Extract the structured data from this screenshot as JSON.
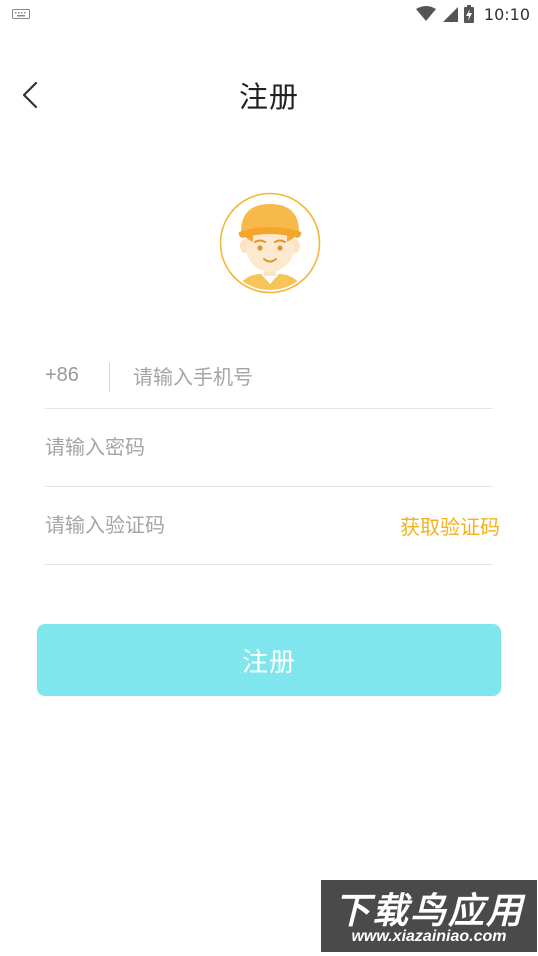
{
  "status_bar": {
    "time": "10:10",
    "icons": [
      "keyboard-icon",
      "wifi-icon",
      "cell-signal-icon",
      "battery-charging-icon"
    ]
  },
  "header": {
    "title": "注册",
    "back_icon": "chevron-left-icon"
  },
  "avatar": {
    "icon": "user-avatar-boy-cap",
    "accent_color": "#f5b63a"
  },
  "form": {
    "phone": {
      "prefix": "+86",
      "placeholder": "请输入手机号",
      "value": ""
    },
    "password": {
      "placeholder": "请输入密码",
      "value": ""
    },
    "code": {
      "placeholder": "请输入验证码",
      "value": "",
      "get_code_label": "获取验证码"
    }
  },
  "submit": {
    "label": "注册",
    "color": "#7fe6ee"
  },
  "colors": {
    "accent": "#f2b21b",
    "primary_button": "#7fe6ee",
    "divider": "#e6e6e6"
  },
  "watermark": {
    "title": "下载鸟应用",
    "url": "www.xiazainiao.com"
  }
}
